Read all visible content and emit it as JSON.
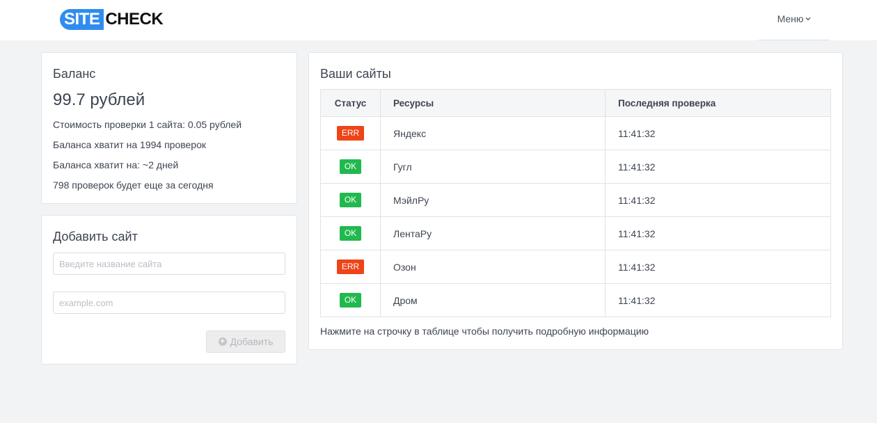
{
  "header": {
    "logo_part1": "SITE",
    "logo_part2": "CHECK",
    "menu_label": "Меню",
    "menu_icon": "chevron-down-icon"
  },
  "balance": {
    "title": "Баланс",
    "amount": "99.7 рублей",
    "lines": [
      "Стоимость проверки 1 сайта: 0.05 рублей",
      "Баланса хватит на 1994 проверок",
      "Баланса хватит на: ~2 дней",
      "798 проверок будет еще за сегодня"
    ]
  },
  "add_site": {
    "title": "Добавить сайт",
    "name_placeholder": "Введите название сайта",
    "url_placeholder": "example.com",
    "button_label": "Добавить",
    "button_icon": "plus-circle-icon"
  },
  "sites": {
    "title": "Ваши сайты",
    "columns": [
      "Статус",
      "Ресурсы",
      "Последняя проверка"
    ],
    "rows": [
      {
        "status": "ERR",
        "name": "Яндекс",
        "time": "11:41:32"
      },
      {
        "status": "OK",
        "name": "Гугл",
        "time": "11:41:32"
      },
      {
        "status": "OK",
        "name": "МэйлРу",
        "time": "11:41:32"
      },
      {
        "status": "OK",
        "name": "ЛентаРу",
        "time": "11:41:32"
      },
      {
        "status": "ERR",
        "name": "Озон",
        "time": "11:41:32"
      },
      {
        "status": "OK",
        "name": "Дром",
        "time": "11:41:32"
      }
    ],
    "hint": "Нажмите на строчку в таблице чтобы получить подробную информацию"
  },
  "colors": {
    "brand": "#2f8cf0",
    "ok": "#21b94e",
    "err": "#ee4418",
    "background": "#f2f3f5"
  }
}
